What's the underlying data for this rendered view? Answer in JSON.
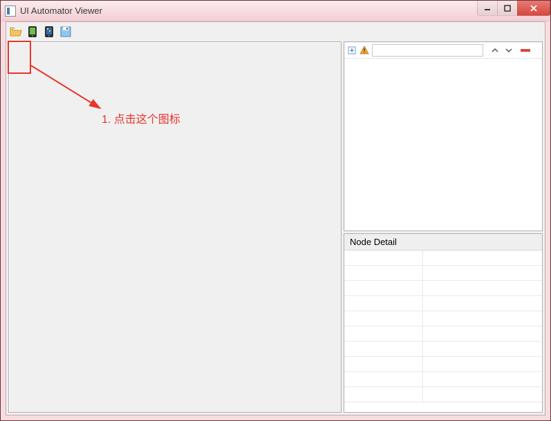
{
  "window": {
    "title": "UI Automator Viewer"
  },
  "toolbar": {
    "open_icon": "folder-open-icon",
    "screenshot_icon": "device-screenshot-icon",
    "hierarchy_icon": "device-hierarchy-icon",
    "save_icon": "save-icon"
  },
  "tree_toolbar": {
    "expand_icon": "expand-all-icon",
    "warn_icon": "warning-icon",
    "search_value": "",
    "prev_icon": "chevron-up-icon",
    "next_icon": "chevron-down-icon",
    "clear_icon": "clear-icon"
  },
  "detail": {
    "title": "Node Detail"
  },
  "annotation": {
    "text": "1. 点击这个图标"
  }
}
